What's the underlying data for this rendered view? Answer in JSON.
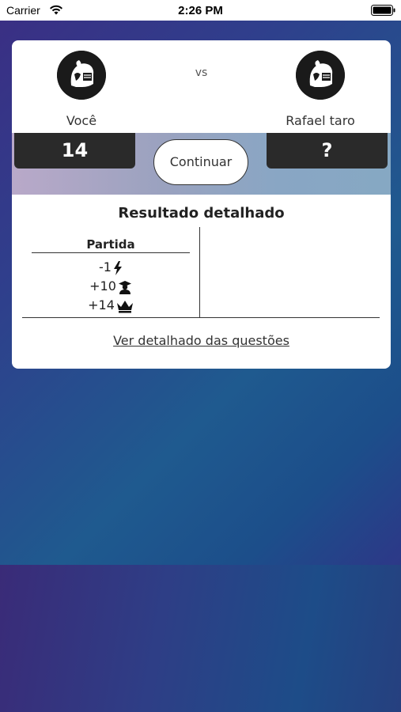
{
  "status_bar": {
    "carrier": "Carrier",
    "time": "2:26 PM",
    "icons": [
      "wifi-icon",
      "battery-icon"
    ]
  },
  "match": {
    "vs_label": "vs",
    "player_left": {
      "name": "Você",
      "score": "14",
      "avatar_icon": "knight-helmet-icon"
    },
    "player_right": {
      "name": "Rafael taro",
      "score": "?",
      "avatar_icon": "knight-helmet-icon"
    },
    "continue_label": "Continuar"
  },
  "results": {
    "title": "Resultado detalhado",
    "column_header": "Partida",
    "rows": [
      {
        "value": "-1",
        "icon": "lightning-icon"
      },
      {
        "value": "+10",
        "icon": "graduate-icon"
      },
      {
        "value": "+14",
        "icon": "crown-icon"
      }
    ],
    "details_link": "Ver detalhado das questões"
  },
  "colors": {
    "score_box": "#2a2a2a",
    "card": "#ffffff",
    "background_top": "#3a2f84",
    "background_mid": "#1f5a8f"
  }
}
